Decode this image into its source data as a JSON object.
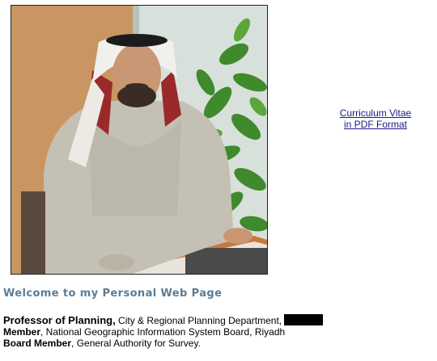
{
  "photo": {
    "alt": "Portrait photo"
  },
  "cv_link": {
    "line1": "Curriculum Vitae",
    "line2": "in PDF Format"
  },
  "welcome": {
    "heading": "Welcome to my Personal Web Page"
  },
  "bio": {
    "professor_label": "Professor of Planning,",
    "professor_text": " City & Regional Planning Department,",
    "member_label": "Member",
    "member_text": ", National Geographic Information System Board, Riyadh",
    "board_label": "Board Member",
    "board_text": ", General Authority for Survey."
  },
  "colors": {
    "heading": "#5b7d96",
    "link": "#1a1a8c"
  }
}
